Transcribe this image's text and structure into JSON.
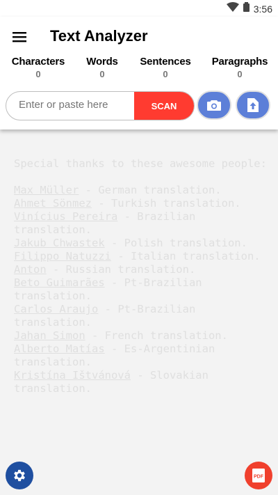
{
  "status_bar": {
    "time": "3:56"
  },
  "app": {
    "title": "Text Analyzer"
  },
  "stats": [
    {
      "label": "Characters",
      "value": "0"
    },
    {
      "label": "Words",
      "value": "0"
    },
    {
      "label": "Sentences",
      "value": "0"
    },
    {
      "label": "Paragraphs",
      "value": "0"
    }
  ],
  "input": {
    "placeholder": "Enter or paste here",
    "value": ""
  },
  "buttons": {
    "scan_label": "SCAN",
    "camera_icon": "camera-icon",
    "upload_icon": "upload-file-icon",
    "settings_icon": "gear-icon",
    "pdf_icon": "pdf-icon",
    "pdf_label": "PDF"
  },
  "content": {
    "intro": "Special thanks to these awesome people:",
    "credits": [
      {
        "name": "Max Müller",
        "desc": " - German translation."
      },
      {
        "name": "Ahmet Sönmez",
        "desc": " - Turkish translation."
      },
      {
        "name": "Vinícius Pereira",
        "desc": " - Brazilian translation."
      },
      {
        "name": "Jakub Chwastek",
        "desc": " - Polish translation."
      },
      {
        "name": "Filippo Natuzzi",
        "desc": " - Italian translation."
      },
      {
        "name": "Anton",
        "desc": " - Russian translation."
      },
      {
        "name": "Beto Guimarães",
        "desc": " - Pt-Brazilian translation."
      },
      {
        "name": "Carlos Araujo",
        "desc": " - Pt-Brazilian translation."
      },
      {
        "name": "Jahan Simon",
        "desc": " - French translation."
      },
      {
        "name": "Alberto Matías",
        "desc": " - Es-Argentinian translation."
      },
      {
        "name": "Kristína Ištvánová",
        "desc": " - Slovakian translation."
      }
    ]
  },
  "colors": {
    "accent_red": "#ff3b30",
    "accent_blue": "#5c7fd8",
    "settings_blue": "#1f4fa0"
  }
}
